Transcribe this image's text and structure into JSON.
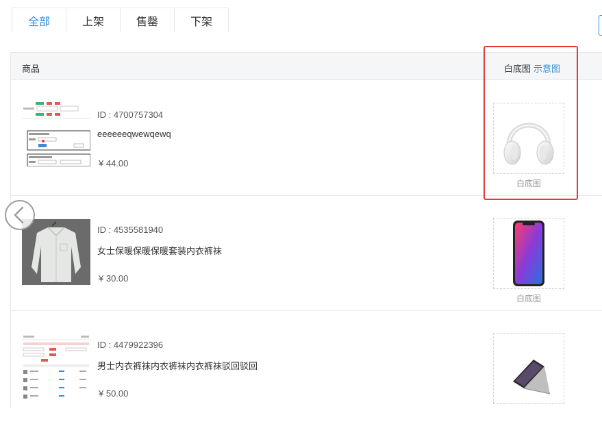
{
  "tabs": [
    {
      "label": "全部",
      "active": true
    },
    {
      "label": "上架",
      "active": false
    },
    {
      "label": "售罄",
      "active": false
    },
    {
      "label": "下架",
      "active": false
    }
  ],
  "table": {
    "col_product": "商品",
    "col_white_bg": "白底图",
    "col_white_bg_link": "示意图"
  },
  "products": [
    {
      "id": "ID : 4700757304",
      "name": "eeeeeeqwewqewq",
      "price": "¥ 44.00",
      "white_bg_label": "白底图",
      "thumb_icon": "screenshot-thumbnail",
      "white_bg_icon": "headphones-image"
    },
    {
      "id": "ID : 4535581940",
      "name": "女士保暖保暖保暖套装内衣裤袜",
      "price": "¥ 30.00",
      "white_bg_label": "白底图",
      "thumb_icon": "shirt-image",
      "white_bg_icon": "phone-image"
    },
    {
      "id": "ID : 4479922396",
      "name": "男士内衣裤袜内衣裤袜内衣裤袜驳回驳回",
      "price": "¥ 50.00",
      "white_bg_label": "",
      "thumb_icon": "screenshot-thumbnail",
      "white_bg_icon": "laptop-image"
    }
  ],
  "colors": {
    "accent": "#2f8ed8",
    "highlight": "#e23b3b",
    "header_bg": "#f5f6f8"
  }
}
